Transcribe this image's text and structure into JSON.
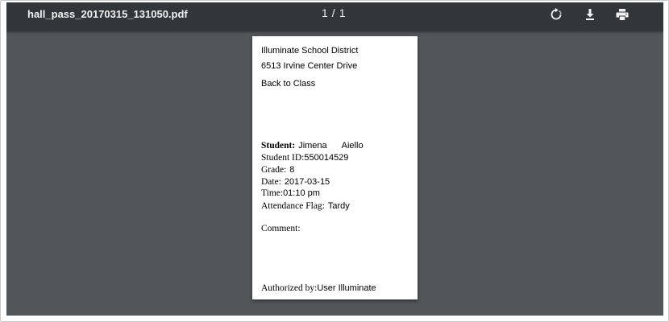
{
  "toolbar": {
    "title": "hall_pass_20170315_131050.pdf",
    "page_current": "1",
    "page_separator": "/",
    "page_total": "1",
    "icons": [
      "rotate-icon",
      "download-icon",
      "print-icon"
    ]
  },
  "document": {
    "district": "Illuminate School District",
    "address": "6513 Irvine Center Drive",
    "heading": "Back to Class",
    "student_label": "Student:",
    "student_first": "Jimena",
    "student_last": "Aiello",
    "student_id_label": "Student ID:",
    "student_id": "550014529",
    "grade_label": "Grade:",
    "grade": "8",
    "date_label": "Date:",
    "date": "2017-03-15",
    "time_label": "Time:",
    "time": "01:10 pm",
    "flag_label": "Attendance Flag:",
    "flag": "Tardy",
    "comment_label": "Comment:",
    "authorized_label": "Authorized by:",
    "authorized_by": "User Illuminate"
  },
  "colors": {
    "viewer_bg": "#525659",
    "toolbar_bg": "#323639",
    "toolbar_text": "#f1f1f1",
    "page_bg": "#ffffff"
  }
}
